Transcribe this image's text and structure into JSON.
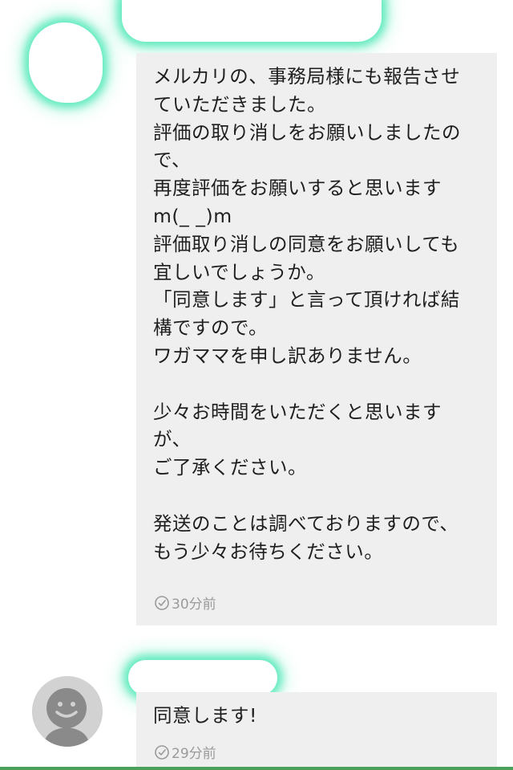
{
  "messages": [
    {
      "sender": "other",
      "text": "メルカリの、事務局様にも報告させていただきました。\n評価の取り消しをお願いしましたので、\n再度評価をお願いすると思いますm(_ _)m\n評価取り消しの同意をお願いしても宜しいでしょうか。\n「同意します」と言って頂ければ結構ですので。\nワガママを申し訳ありません。\n\n少々お時間をいただくと思いますが、\nご了承ください。\n\n発送のことは調べておりますので、もう少々お待ちください。",
      "time": "30分前"
    },
    {
      "sender": "self",
      "text": "同意します!",
      "time": "29分前"
    }
  ],
  "colors": {
    "bubble": "#efefef",
    "text": "#1e1e1e",
    "time": "#9a9a9a",
    "redaction_glow": "#40e6b0",
    "accent_green": "#4aa25a"
  },
  "icons": {
    "time": "clock-icon",
    "default_avatar": "default-avatar-icon"
  }
}
